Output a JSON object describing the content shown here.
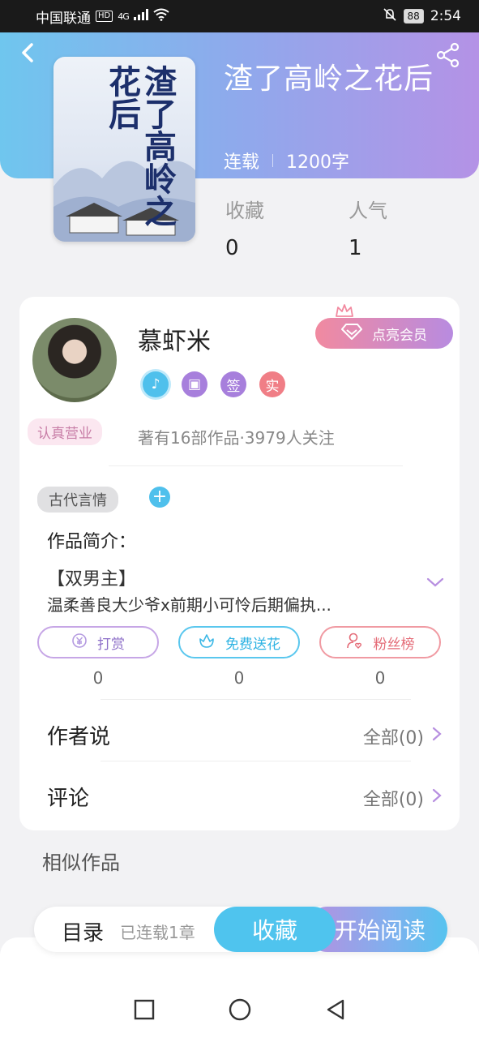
{
  "status_bar": {
    "carrier": "中国联通",
    "hd": "HD",
    "signal": "4G",
    "battery": "88",
    "time": "2:54"
  },
  "book": {
    "title": "渣了高岭之花后",
    "cover_title": "渣了高岭之花后",
    "status": "连载",
    "word_count": "1200字"
  },
  "stats": {
    "favorites_label": "收藏",
    "favorites_value": "0",
    "popularity_label": "人气",
    "popularity_value": "1"
  },
  "author": {
    "name": "慕虾米",
    "vip_label": "点亮会员",
    "badge_sign": "签",
    "badge_real": "实",
    "tag": "认真营业",
    "info": "著有16部作品·3979人关注"
  },
  "genre_tag": "古代言情",
  "intro": {
    "label": "作品简介：",
    "line1": "【双男主】",
    "line2": "温柔善良大少爷x前期小可怜后期偏执..."
  },
  "actions": [
    {
      "label": "打赏",
      "count": "0"
    },
    {
      "label": "免费送花",
      "count": "0"
    },
    {
      "label": "粉丝榜",
      "count": "0"
    }
  ],
  "author_says": {
    "label": "作者说",
    "right": "全部(0)"
  },
  "comments": {
    "label": "评论",
    "right": "全部(0)"
  },
  "similar_title": "相似作品",
  "bottom_bar": {
    "toc": "目录",
    "chapters": "已连载1章",
    "collect": "收藏",
    "read": "开始阅读"
  },
  "colors": {
    "accent_blue": "#4fc4ee",
    "accent_purple": "#b78fe0",
    "accent_pink": "#f18aa0"
  }
}
